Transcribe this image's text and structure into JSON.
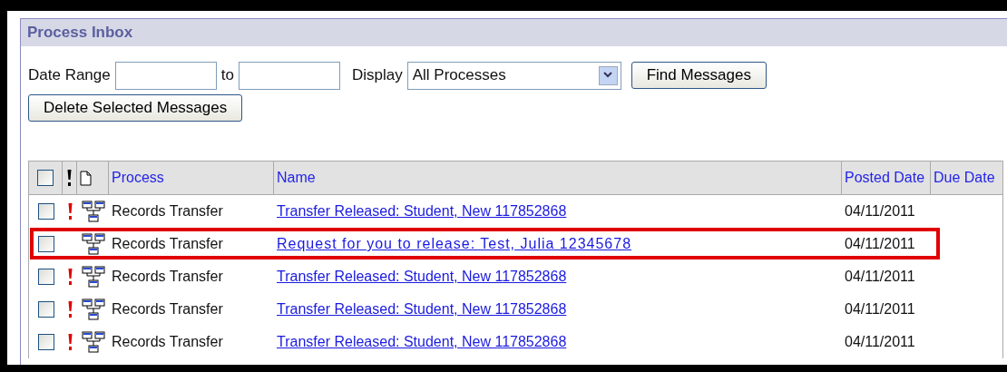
{
  "panel": {
    "title": "Process Inbox"
  },
  "filters": {
    "date_range_label": "Date Range",
    "to_label": "to",
    "display_label": "Display",
    "display_value": "All Processes",
    "find_button": "Find Messages"
  },
  "delete_button": "Delete Selected Messages",
  "table": {
    "select_all_checked": false,
    "columns": [
      "Process",
      "Name",
      "Posted Date",
      "Due Date"
    ],
    "rows": [
      {
        "checked": false,
        "urgent": true,
        "highlighted": false,
        "process": "Records Transfer",
        "name": "Transfer Released: Student, New 117852868",
        "posted": "04/11/2011"
      },
      {
        "checked": false,
        "urgent": false,
        "highlighted": true,
        "process": "Records Transfer",
        "name": "Request for you to release: Test, Julia 12345678",
        "posted": "04/11/2011"
      },
      {
        "checked": false,
        "urgent": true,
        "highlighted": false,
        "process": "Records Transfer",
        "name": "Transfer Released: Student, New 117852868",
        "posted": "04/11/2011"
      },
      {
        "checked": false,
        "urgent": true,
        "highlighted": false,
        "process": "Records Transfer",
        "name": "Transfer Released: Student, New 117852868",
        "posted": "04/11/2011"
      },
      {
        "checked": false,
        "urgent": true,
        "highlighted": false,
        "process": "Records Transfer",
        "name": "Transfer Released: Student, New 117852868",
        "posted": "04/11/2011"
      }
    ]
  }
}
